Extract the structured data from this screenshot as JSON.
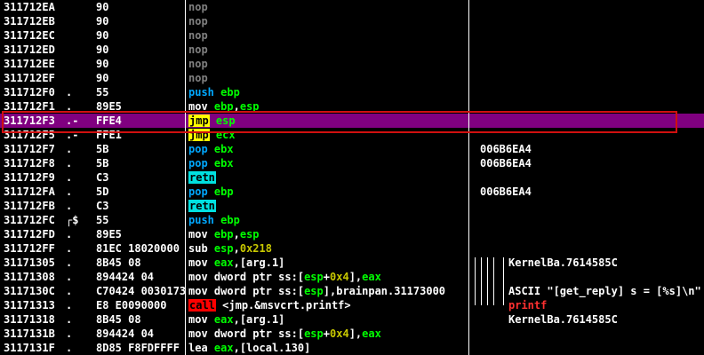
{
  "colors": {
    "background": "#000000",
    "selection": "#800080",
    "selection_box": "#d01010",
    "jmp_highlight": "#ffff00",
    "call_highlight": "#ff0000",
    "retn_highlight": "#00e0e0",
    "register_color": "#00ff00",
    "number_color": "#c8c800",
    "stack_op_color": "#00a8ff",
    "nop_color": "#808080"
  },
  "rows": [
    {
      "addr": "311712EA",
      "mark": "",
      "hex": "90",
      "mn": "nop",
      "op": "",
      "cmt": ""
    },
    {
      "addr": "311712EB",
      "mark": "",
      "hex": "90",
      "mn": "nop",
      "op": "",
      "cmt": ""
    },
    {
      "addr": "311712EC",
      "mark": "",
      "hex": "90",
      "mn": "nop",
      "op": "",
      "cmt": ""
    },
    {
      "addr": "311712ED",
      "mark": "",
      "hex": "90",
      "mn": "nop",
      "op": "",
      "cmt": ""
    },
    {
      "addr": "311712EE",
      "mark": "",
      "hex": "90",
      "mn": "nop",
      "op": "",
      "cmt": ""
    },
    {
      "addr": "311712EF",
      "mark": "",
      "hex": "90",
      "mn": "nop",
      "op": "",
      "cmt": ""
    },
    {
      "addr": "311712F0",
      "mark": ".",
      "hex": "55",
      "mn": "push",
      "op": "ebp",
      "cmt": ""
    },
    {
      "addr": "311712F1",
      "mark": ".",
      "hex": "89E5",
      "mn": "mov",
      "op": "ebp,esp",
      "cmt": ""
    },
    {
      "addr": "311712F3",
      "mark": ".-",
      "hex": "FFE4",
      "mn": "jmp",
      "op": "esp",
      "cmt": "",
      "selected": true
    },
    {
      "addr": "311712F5",
      "mark": ".-",
      "hex": "FFE1",
      "mn": "jmp",
      "op": "ecx",
      "cmt": ""
    },
    {
      "addr": "311712F7",
      "mark": ".",
      "hex": "5B",
      "mn": "pop",
      "op": "ebx",
      "cmt": "006B6EA4"
    },
    {
      "addr": "311712F8",
      "mark": ".",
      "hex": "5B",
      "mn": "pop",
      "op": "ebx",
      "cmt": "006B6EA4"
    },
    {
      "addr": "311712F9",
      "mark": ".",
      "hex": "C3",
      "mn": "retn",
      "op": "",
      "cmt": ""
    },
    {
      "addr": "311712FA",
      "mark": ".",
      "hex": "5D",
      "mn": "pop",
      "op": "ebp",
      "cmt": "006B6EA4"
    },
    {
      "addr": "311712FB",
      "mark": ".",
      "hex": "C3",
      "mn": "retn",
      "op": "",
      "cmt": ""
    },
    {
      "addr": "311712FC",
      "mark": "┌$",
      "hex": "55",
      "mn": "push",
      "op": "ebp",
      "cmt": ""
    },
    {
      "addr": "311712FD",
      "mark": ".",
      "hex": "89E5",
      "mn": "mov",
      "op": "ebp,esp",
      "cmt": ""
    },
    {
      "addr": "311712FF",
      "mark": ".",
      "hex": "81EC 18020000",
      "mn": "sub",
      "op": "esp,0x218",
      "cmt": ""
    },
    {
      "addr": "31171305",
      "mark": ".",
      "hex": "8B45 08",
      "mn": "mov",
      "op": "eax,[arg.1]",
      "cmt": "KernelBa.7614585C"
    },
    {
      "addr": "31171308",
      "mark": ".",
      "hex": "894424 04",
      "mn": "mov",
      "op": "dword ptr ss:[esp+0x4],eax",
      "cmt": ""
    },
    {
      "addr": "3117130C",
      "mark": ".",
      "hex": "C70424 00301731",
      "mn": "mov",
      "op": "dword ptr ss:[esp],brainpan.31173000",
      "cmt": "ASCII \"[get_reply] s = [%s]\\n\""
    },
    {
      "addr": "31171313",
      "mark": ".",
      "hex": "E8 E0090000",
      "mn": "call",
      "op": "<jmp.&msvcrt.printf>",
      "cmt": "printf"
    },
    {
      "addr": "31171318",
      "mark": ".",
      "hex": "8B45 08",
      "mn": "mov",
      "op": "eax,[arg.1]",
      "cmt": "KernelBa.7614585C"
    },
    {
      "addr": "3117131B",
      "mark": ".",
      "hex": "894424 04",
      "mn": "mov",
      "op": "dword ptr ss:[esp+0x4],eax",
      "cmt": ""
    },
    {
      "addr": "3117131F",
      "mark": ".",
      "hex": "8D85 F8FDFFFF",
      "mn": "lea",
      "op": "eax,[local.130]",
      "cmt": ""
    }
  ]
}
